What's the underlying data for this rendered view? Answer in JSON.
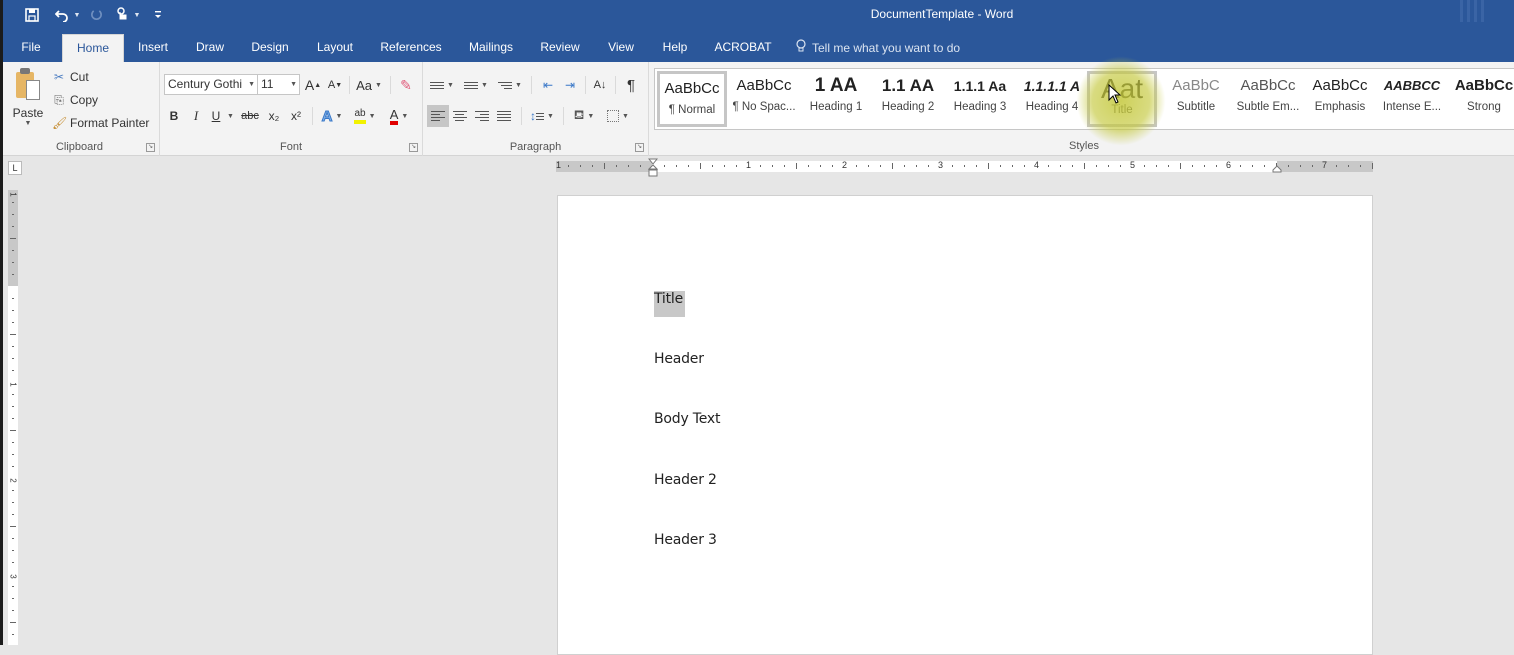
{
  "window": {
    "title": "DocumentTemplate  -  Word"
  },
  "quick_access": [
    {
      "name": "save-icon",
      "glyph": "🖫"
    },
    {
      "name": "undo-icon",
      "glyph": "↶"
    },
    {
      "name": "redo-icon",
      "glyph": "↻"
    },
    {
      "name": "touch-mode-icon",
      "glyph": "☝"
    },
    {
      "name": "customize-qat-icon",
      "glyph": "≡"
    }
  ],
  "tabs": [
    {
      "label": "File",
      "active": false
    },
    {
      "label": "Home",
      "active": true
    },
    {
      "label": "Insert",
      "active": false
    },
    {
      "label": "Draw",
      "active": false
    },
    {
      "label": "Design",
      "active": false
    },
    {
      "label": "Layout",
      "active": false
    },
    {
      "label": "References",
      "active": false
    },
    {
      "label": "Mailings",
      "active": false
    },
    {
      "label": "Review",
      "active": false
    },
    {
      "label": "View",
      "active": false
    },
    {
      "label": "Help",
      "active": false
    },
    {
      "label": "ACROBAT",
      "active": false
    }
  ],
  "tell_me": {
    "placeholder": "Tell me what you want to do",
    "icon": "lightbulb-icon"
  },
  "ribbon": {
    "clipboard": {
      "label": "Clipboard",
      "paste": "Paste",
      "cut": "Cut",
      "copy": "Copy",
      "format_painter": "Format Painter"
    },
    "font": {
      "label": "Font",
      "font_name": "Century Gothi",
      "font_size": "11",
      "grow": "A",
      "shrink": "A",
      "change_case": "Aa",
      "bold": "B",
      "italic": "I",
      "underline": "U",
      "strikethrough": "abc",
      "subscript": "x₂",
      "superscript": "x²",
      "text_effects": "A",
      "highlight": "ab",
      "font_color": "A",
      "highlight_color": "#ffff00",
      "font_color_value": "#e00000"
    },
    "paragraph": {
      "label": "Paragraph",
      "sort": "A↓",
      "show_marks": "¶"
    },
    "styles": {
      "label": "Styles",
      "items": [
        {
          "preview": "AaBbCc",
          "name": "¶ Normal",
          "selected": true
        },
        {
          "preview": "AaBbCc",
          "name": "¶ No Spac...",
          "selected": false
        },
        {
          "preview": "1  AA",
          "name": "Heading 1",
          "selected": false
        },
        {
          "preview": "1.1  AA",
          "name": "Heading 2",
          "selected": false
        },
        {
          "preview": "1.1.1  Aa",
          "name": "Heading 3",
          "selected": false
        },
        {
          "preview": "1.1.1.1  A",
          "name": "Heading 4",
          "selected": false
        },
        {
          "preview": "Aat",
          "name": "Title",
          "selected": false,
          "hovered": true
        },
        {
          "preview": "AaBbC",
          "name": "Subtitle",
          "selected": false
        },
        {
          "preview": "AaBbCc",
          "name": "Subtle Em...",
          "selected": false
        },
        {
          "preview": "AaBbCc",
          "name": "Emphasis",
          "selected": false
        },
        {
          "preview": "AABBCC",
          "name": "Intense E...",
          "selected": false
        },
        {
          "preview": "AaBbCc",
          "name": "Strong",
          "selected": false
        }
      ]
    }
  },
  "ruler": {
    "h_labels": [
      "1",
      "1",
      "2",
      "3",
      "4",
      "5",
      "6",
      "7"
    ],
    "v_labels": [
      "1",
      "1",
      "2",
      "3"
    ]
  },
  "document": {
    "paragraphs": [
      {
        "text": "Title",
        "selected": true
      },
      {
        "text": "Header",
        "selected": false
      },
      {
        "text": "Body Text",
        "selected": false
      },
      {
        "text": "Header 2",
        "selected": false
      },
      {
        "text": "Header 3",
        "selected": false
      }
    ]
  },
  "colors": {
    "ribbon_blue": "#2b579a",
    "ribbon_bg": "#f3f3f3",
    "hover_highlight": "#c4c83c"
  }
}
